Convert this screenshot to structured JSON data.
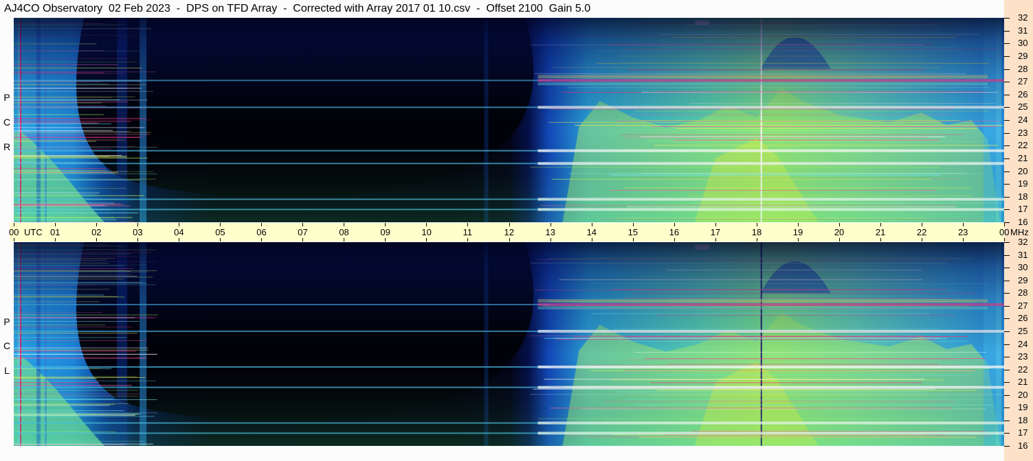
{
  "title": "AJ4CO Observatory  02 Feb 2023  -  DPS on TFD Array  -  Corrected with Array 2017 01 10.csv  -  Offset 2100  Gain 5.0",
  "chart_data": [
    {
      "type": "heatmap",
      "name": "RCP",
      "polarization_letters": [
        "P",
        "C",
        "R"
      ],
      "x_range_utc_hours": [
        0,
        24
      ],
      "y_range_mhz": [
        16,
        32
      ],
      "bright_bands_mhz": [
        27.1,
        25.0,
        21.6,
        20.6,
        17.8,
        17.0
      ],
      "day_onset_utc": 12.6,
      "vertical_marker_utc": 18.1
    },
    {
      "type": "heatmap",
      "name": "LCP",
      "polarization_letters": [
        "P",
        "C",
        "L"
      ],
      "x_range_utc_hours": [
        0,
        24
      ],
      "y_range_mhz": [
        16,
        32
      ],
      "bright_bands_mhz": [
        27.1,
        25.0,
        22.2,
        20.6,
        17.8,
        17.0
      ],
      "day_onset_utc": 12.6,
      "vertical_marker_utc": 18.1
    }
  ],
  "time_axis": {
    "labels": [
      "00",
      "01",
      "02",
      "03",
      "04",
      "05",
      "06",
      "07",
      "08",
      "09",
      "10",
      "11",
      "12",
      "13",
      "14",
      "15",
      "16",
      "17",
      "18",
      "19",
      "20",
      "21",
      "22",
      "23",
      "00"
    ],
    "unit_left": "UTC",
    "unit_right": "MHz"
  },
  "freq_axis": {
    "labels": [
      "32",
      "31",
      "30",
      "29",
      "28",
      "27",
      "26",
      "25",
      "24",
      "23",
      "22",
      "21",
      "20",
      "19",
      "18",
      "17",
      "16"
    ]
  }
}
